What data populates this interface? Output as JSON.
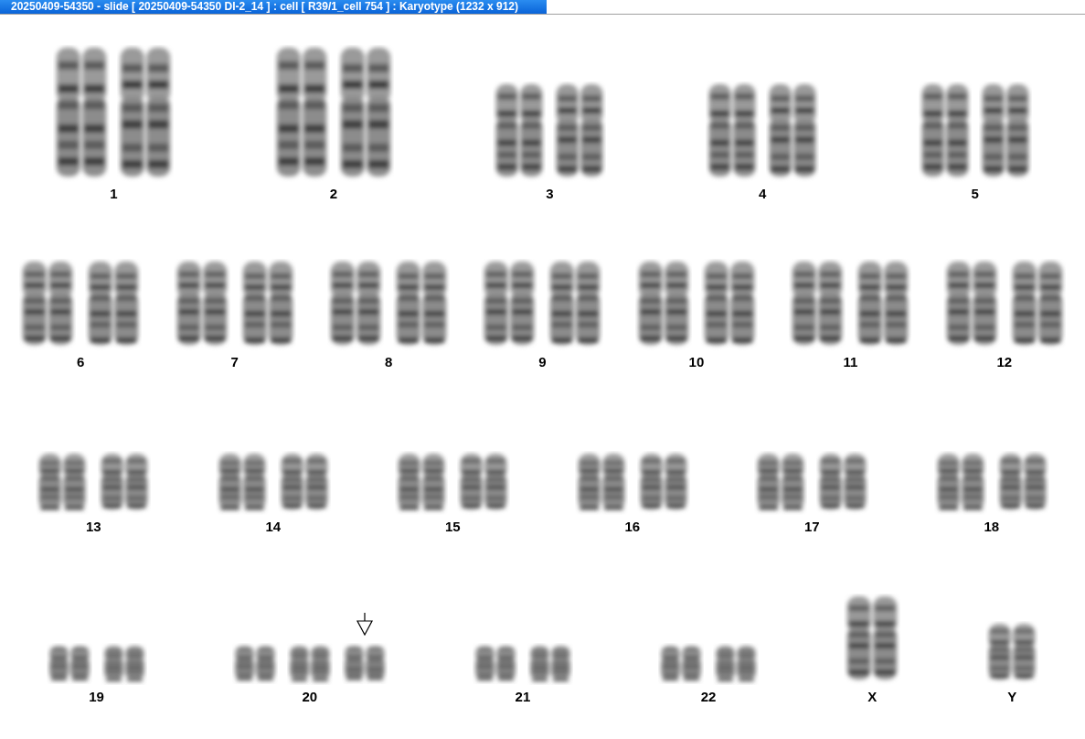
{
  "window": {
    "title": "20250409-54350 - slide [ 20250409-54350 DI-2_14 ] : cell [ R39/1_cell 754 ] : Karyotype  (1232 x 912)"
  },
  "rows": [
    {
      "groups": [
        {
          "label": "1",
          "chromosomes": [
            {
              "kind": "xl"
            },
            {
              "kind": "xl"
            }
          ]
        },
        {
          "label": "2",
          "chromosomes": [
            {
              "kind": "xl"
            },
            {
              "kind": "xl"
            }
          ]
        },
        {
          "label": "3",
          "chromosomes": [
            {
              "kind": "l"
            },
            {
              "kind": "l"
            }
          ]
        },
        {
          "label": "4",
          "chromosomes": [
            {
              "kind": "l"
            },
            {
              "kind": "l"
            }
          ]
        },
        {
          "label": "5",
          "chromosomes": [
            {
              "kind": "l"
            },
            {
              "kind": "l"
            }
          ]
        }
      ]
    },
    {
      "groups": [
        {
          "label": "6",
          "chromosomes": [
            {
              "kind": "m"
            },
            {
              "kind": "m"
            }
          ]
        },
        {
          "label": "7",
          "chromosomes": [
            {
              "kind": "m"
            },
            {
              "kind": "m"
            }
          ]
        },
        {
          "label": "8",
          "chromosomes": [
            {
              "kind": "m"
            },
            {
              "kind": "m"
            }
          ]
        },
        {
          "label": "9",
          "chromosomes": [
            {
              "kind": "m"
            },
            {
              "kind": "m"
            }
          ]
        },
        {
          "label": "10",
          "chromosomes": [
            {
              "kind": "m"
            },
            {
              "kind": "m"
            }
          ]
        },
        {
          "label": "11",
          "chromosomes": [
            {
              "kind": "m"
            },
            {
              "kind": "m"
            }
          ]
        },
        {
          "label": "12",
          "chromosomes": [
            {
              "kind": "m"
            },
            {
              "kind": "m"
            }
          ]
        }
      ]
    },
    {
      "groups": [
        {
          "label": "13",
          "chromosomes": [
            {
              "kind": "s"
            },
            {
              "kind": "s"
            }
          ]
        },
        {
          "label": "14",
          "chromosomes": [
            {
              "kind": "s"
            },
            {
              "kind": "s"
            }
          ]
        },
        {
          "label": "15",
          "chromosomes": [
            {
              "kind": "s"
            },
            {
              "kind": "s"
            }
          ]
        },
        {
          "label": "16",
          "chromosomes": [
            {
              "kind": "s"
            },
            {
              "kind": "s"
            }
          ]
        },
        {
          "label": "17",
          "chromosomes": [
            {
              "kind": "s"
            },
            {
              "kind": "s"
            }
          ]
        },
        {
          "label": "18",
          "chromosomes": [
            {
              "kind": "s"
            },
            {
              "kind": "s"
            }
          ]
        }
      ]
    },
    {
      "groups": [
        {
          "label": "19",
          "chromosomes": [
            {
              "kind": "xs"
            },
            {
              "kind": "xs"
            }
          ]
        },
        {
          "label": "20",
          "chromosomes": [
            {
              "kind": "xs"
            },
            {
              "kind": "xs"
            },
            {
              "kind": "marked"
            }
          ]
        },
        {
          "label": "21",
          "chromosomes": [
            {
              "kind": "xs"
            },
            {
              "kind": "xs"
            }
          ]
        },
        {
          "label": "22",
          "chromosomes": [
            {
              "kind": "xs"
            },
            {
              "kind": "xs"
            }
          ]
        },
        {
          "label": "X",
          "chromosomes": [
            {
              "kind": "m"
            }
          ]
        },
        {
          "label": "Y",
          "chromosomes": [
            {
              "kind": "s"
            }
          ]
        }
      ]
    }
  ]
}
